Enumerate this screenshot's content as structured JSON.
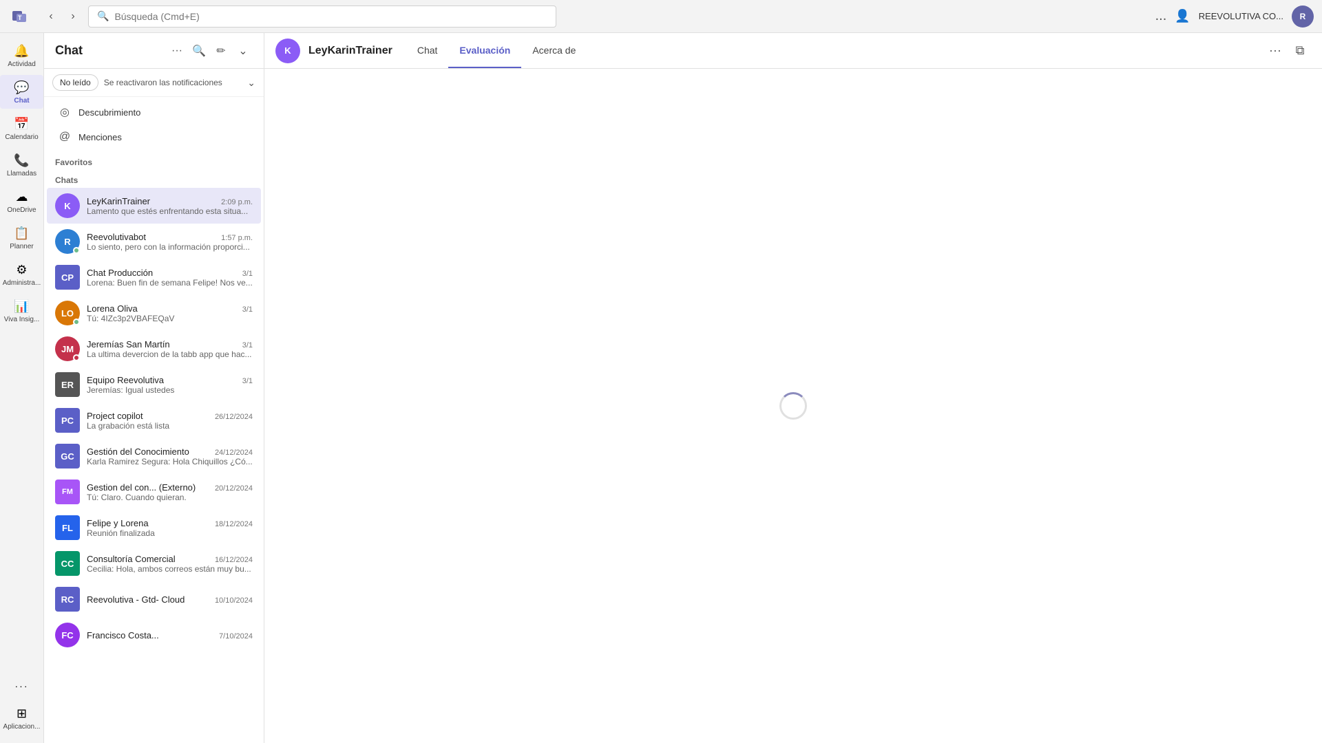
{
  "topBar": {
    "searchPlaceholder": "Búsqueda (Cmd+E)",
    "userDisplayName": "REEVOLUTIVA CO...",
    "moreOptionsLabel": "..."
  },
  "sidebar": {
    "items": [
      {
        "id": "actividad",
        "label": "Actividad",
        "icon": "🔔"
      },
      {
        "id": "chat",
        "label": "Chat",
        "icon": "💬",
        "active": true
      },
      {
        "id": "calendario",
        "label": "Calendario",
        "icon": "📅"
      },
      {
        "id": "llamadas",
        "label": "Llamadas",
        "icon": "📞"
      },
      {
        "id": "onedrive",
        "label": "OneDrive",
        "icon": "☁"
      },
      {
        "id": "planner",
        "label": "Planner",
        "icon": "📋"
      },
      {
        "id": "administra",
        "label": "Administra...",
        "icon": "⚙"
      },
      {
        "id": "viva",
        "label": "Viva Insig...",
        "icon": "📊"
      }
    ],
    "bottomItems": [
      {
        "id": "more",
        "label": "...",
        "icon": "···"
      },
      {
        "id": "aplicaciones",
        "label": "Aplicacion...",
        "icon": "⊞"
      }
    ]
  },
  "chatListPanel": {
    "title": "Chat",
    "filterButtons": [
      {
        "label": "No leído"
      }
    ],
    "filterBannerText": "Se reactivaron las notificaciones",
    "navItems": [
      {
        "id": "descubrimiento",
        "label": "Descubrimiento",
        "icon": "◎"
      },
      {
        "id": "menciones",
        "label": "Menciones",
        "icon": "@"
      }
    ],
    "sections": [
      {
        "id": "favoritos",
        "label": "Favoritos"
      },
      {
        "id": "chats",
        "label": "Chats"
      }
    ],
    "chatItems": [
      {
        "id": "leykarintrainer",
        "name": "LeyKarinTrainer",
        "time": "2:09 p.m.",
        "preview": "Lamento que estés enfrentando esta situa...",
        "avatarText": "K",
        "avatarColor": "av-purple",
        "avatarImg": true,
        "statusColor": "",
        "badge": "",
        "active": true
      },
      {
        "id": "reevolutivabot",
        "name": "Reevolutivabot",
        "time": "1:57 p.m.",
        "preview": "Lo siento, pero con la información proporci...",
        "avatarText": "R",
        "avatarColor": "av-blue",
        "statusColor": "green",
        "badge": "",
        "active": false
      },
      {
        "id": "chatproduccion",
        "name": "Chat Producción",
        "time": "3/1",
        "preview": "Lorena: Buen fin de semana Felipe! Nos ve...",
        "avatarText": "CP",
        "avatarColor": "av-gc",
        "statusColor": "",
        "badge": "3/1",
        "badgeShow": false,
        "active": false
      },
      {
        "id": "lorenaoliva",
        "name": "Lorena Oliva",
        "time": "3/1",
        "preview": "Tú: 4IZc3p2VBAFEQaV",
        "avatarText": "LO",
        "avatarColor": "av-lo",
        "statusColor": "green",
        "badge": "",
        "active": false
      },
      {
        "id": "jeremiassanmartin",
        "name": "Jeremías San Martín",
        "time": "3/1",
        "preview": "La ultima devercion de la tabb app que hac...",
        "avatarText": "JM",
        "avatarColor": "av-jm",
        "statusColor": "dnd",
        "badge": "",
        "active": false
      },
      {
        "id": "equiporeevolutiva",
        "name": "Equipo Reevolutiva",
        "time": "3/1",
        "preview": "Jeremías: Igual ustedes",
        "avatarText": "ER",
        "avatarColor": "av-eq",
        "statusColor": "",
        "badge": "",
        "active": false
      },
      {
        "id": "projectcopilot",
        "name": "Project copilot",
        "time": "26/12/2024",
        "preview": "La grabación está lista",
        "avatarText": "PC",
        "avatarColor": "av-pc",
        "statusColor": "",
        "badge": "",
        "active": false
      },
      {
        "id": "gestionconocimiento",
        "name": "Gestión del Conocimiento",
        "time": "24/12/2024",
        "preview": "Karla Ramirez Segura: Hola Chiquillos ¿Có...",
        "avatarText": "GC",
        "avatarColor": "av-gc",
        "statusColor": "",
        "badge": "",
        "active": false
      },
      {
        "id": "gestionexterno",
        "name": "Gestion del con... (Externo)",
        "time": "20/12/2024",
        "preview": "Tú: Claro. Cuando quieran.",
        "avatarText": "FM",
        "avatarColor": "av-ext",
        "statusColor": "",
        "badge": "",
        "active": false
      },
      {
        "id": "felipelorena",
        "name": "Felipe y Lorena",
        "time": "18/12/2024",
        "preview": "Reunión finalizada",
        "avatarText": "FL",
        "avatarColor": "av-fl",
        "statusColor": "",
        "badge": "",
        "active": false
      },
      {
        "id": "consultoriacomercial",
        "name": "Consultoría Comercial",
        "time": "16/12/2024",
        "preview": "Cecilia: Hola, ambos correos están muy bu...",
        "avatarText": "CC",
        "avatarColor": "av-cc",
        "statusColor": "",
        "badge": "",
        "active": false
      },
      {
        "id": "reevolutivacloud",
        "name": "Reevolutiva - Gtd- Cloud",
        "time": "10/10/2024",
        "preview": "",
        "avatarText": "RC",
        "avatarColor": "av-cl",
        "statusColor": "",
        "badge": "",
        "active": false
      },
      {
        "id": "franciscocosta",
        "name": "Francisco Costa...",
        "time": "7/10/2024",
        "preview": "",
        "avatarText": "FC",
        "avatarColor": "av-fc",
        "statusColor": "",
        "badge": "",
        "active": false
      }
    ]
  },
  "mainContent": {
    "headerName": "LeyKarinTrainer",
    "tabs": [
      {
        "id": "chat",
        "label": "Chat",
        "active": false
      },
      {
        "id": "evaluacion",
        "label": "Evaluación",
        "active": true
      },
      {
        "id": "acercade",
        "label": "Acerca de",
        "active": false
      }
    ]
  }
}
